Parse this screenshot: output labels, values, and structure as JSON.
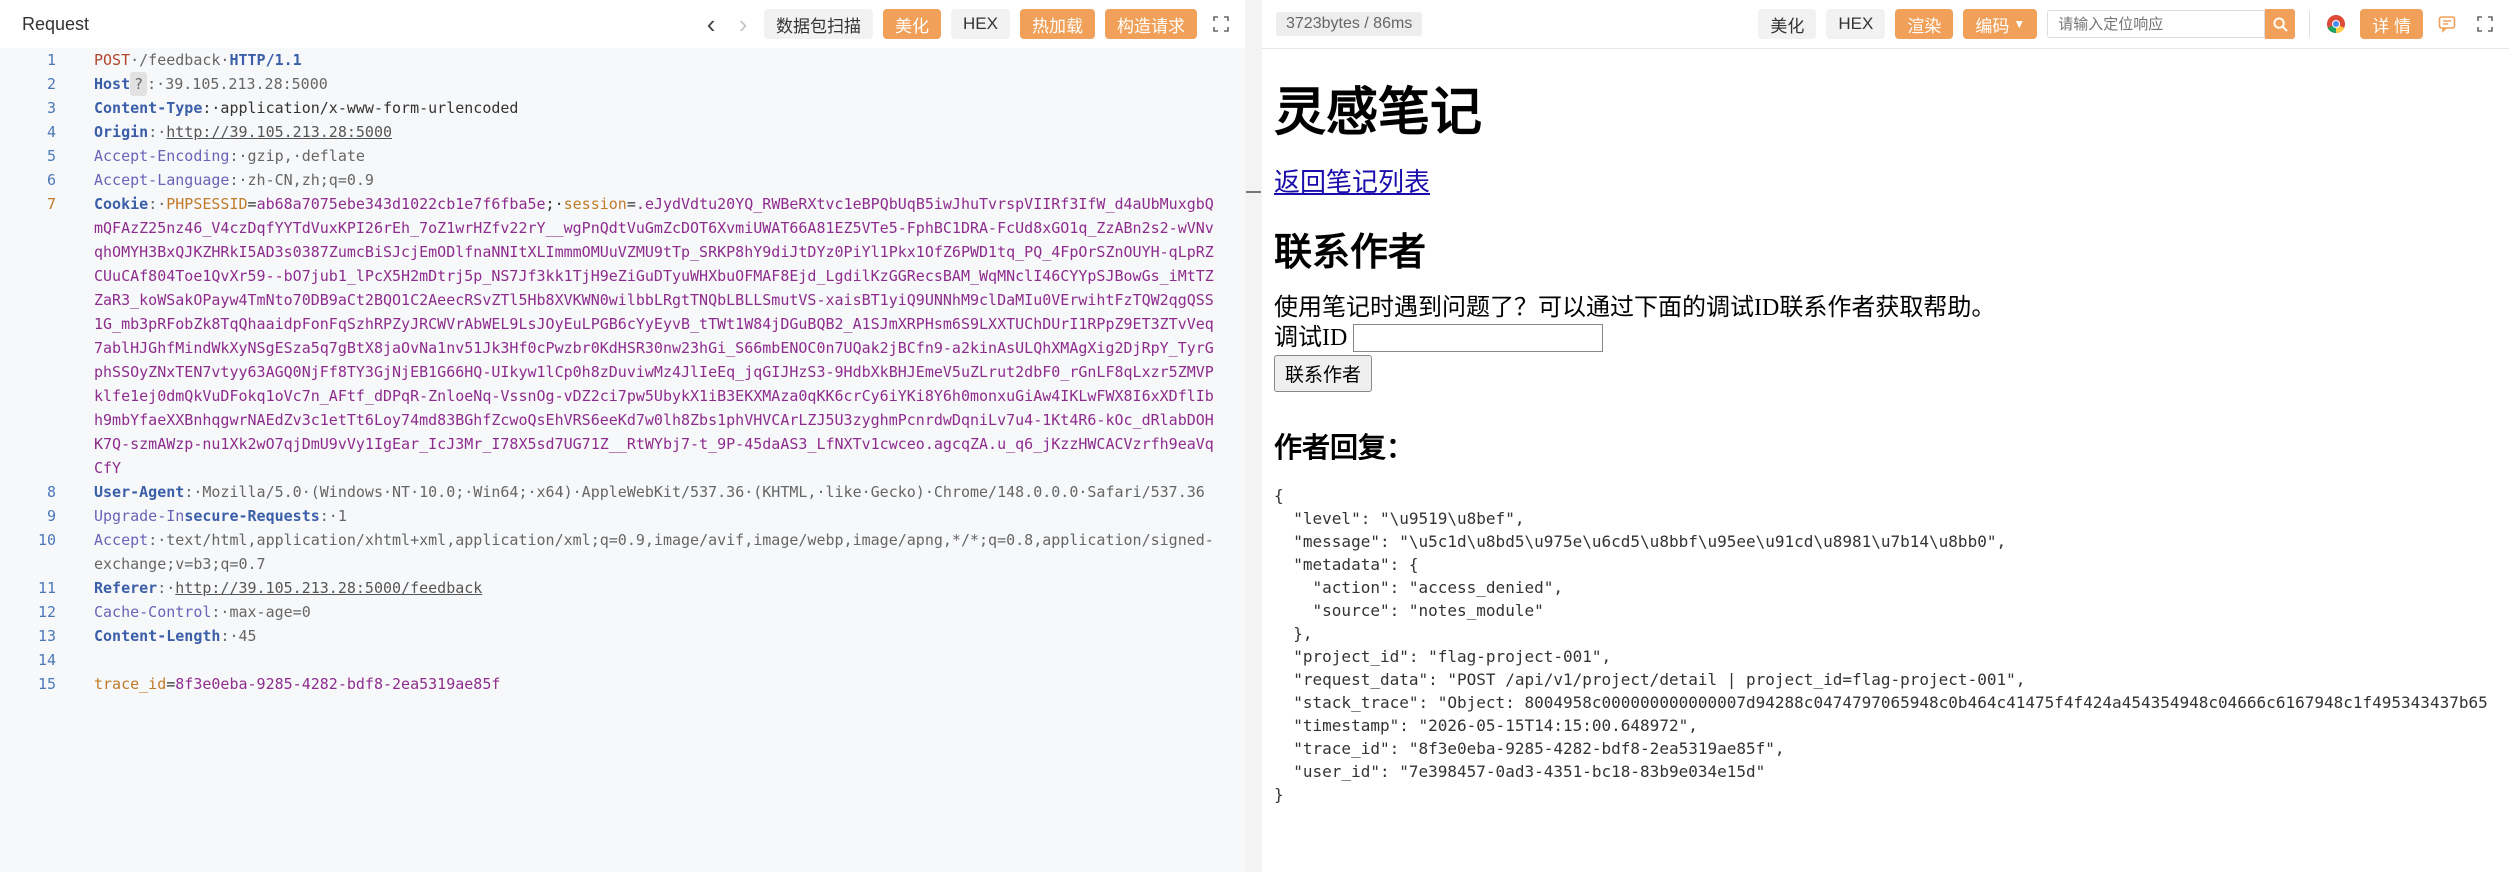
{
  "request_panel": {
    "title": "Request",
    "buttons": [
      "数据包扫描",
      "美化",
      "HEX",
      "热加载",
      "构造请求"
    ],
    "lines": [
      {
        "n": "1",
        "segs": [
          [
            "red",
            "POST"
          ],
          [
            "grey",
            "·/feedback·"
          ],
          [
            "k",
            "HTTP/1.1"
          ]
        ]
      },
      {
        "n": "2",
        "segs": [
          [
            "k",
            "Host"
          ],
          [
            "badge",
            "?"
          ],
          [
            "grey",
            ":·39.105.213.28:5000"
          ]
        ]
      },
      {
        "n": "3",
        "segs": [
          [
            "k",
            "Content-Type"
          ],
          [
            "",
            ":·application/x-www-form-urlencoded"
          ]
        ]
      },
      {
        "n": "4",
        "segs": [
          [
            "k",
            "Origin"
          ],
          [
            "grey",
            ":·"
          ],
          [
            "url",
            "http://39.105.213.28:5000"
          ]
        ]
      },
      {
        "n": "5",
        "segs": [
          [
            "kp",
            "Accept-Encoding"
          ],
          [
            "grey",
            ":·gzip,·deflate"
          ]
        ]
      },
      {
        "n": "6",
        "segs": [
          [
            "kp",
            "Accept-Language"
          ],
          [
            "grey",
            ":·zh-CN,zh;q=0.9"
          ]
        ]
      },
      {
        "n": "7",
        "segs": [
          [
            "k",
            "Cookie"
          ],
          [
            "grey",
            ":·"
          ],
          [
            "ck",
            "PHPSESSID"
          ],
          [
            "",
            "="
          ],
          [
            "cv",
            "ab68a7075ebe343d1022cb1e7f6fba5e"
          ],
          [
            "",
            ";·"
          ],
          [
            "ck",
            "session"
          ],
          [
            "",
            "="
          ],
          [
            "cv",
            ".eJydVdtu20YQ_RWBeRXtvc1eBPQbUqB5iwJhuTvrspVIIRf3IfW_d4aUbMuxgbQmQFAzZ25nz46_V4czDqfYYTdVuxKPI26rEh_7oZ1wrHZfv22rY__wgPnQdtVuGmZcDOT6XvmiUWAT66A81EZ5VTe5-FphBC1DRA-FcUd8xGO1q_ZzABn2s2-wVNvqhOMYH3BxQJKZHRkI5AD3s0387ZumcBiSJcjEmODlfnaNNItXLImmmOMUuVZMU9tTp_SRKP8hY9diJtDYz0PiYl1Pkx1OfZ6PWD1tq_PQ_4FpOrSZnOUYH-qLpRZCUuCAf804Toe1QvXr59--bO7jub1_lPcX5H2mDtrj5p_NS7Jf3kk1TjH9eZiGuDTyuWHXbuOFMAF8Ejd_LgdilKzGGRecsBAM_WqMNclI46CYYpSJBowGs_iMtTZZaR3_koWSakOPayw4TmNto70DB9aCt2BQO1C2AeecRSvZTl5Hb8XVKWN0wilbbLRgtTNQbLBLLSmutVS-xaisBT1yiQ9UNNhM9clDaMIu0VErwihtFzTQW2qgQSS1G_mb3pRFobZk8TqQhaaidpFonFqSzhRPZyJRCWVrAbWEL9LsJOyEuLPGB6cYyEyvB_tTWt1W84jDGuBQB2_A1SJmXRPHsm6S9LXXTUChDUrI1RPpZ9ET3ZTvVeq7ablHJGhfMindWkXyNSgESza5q7gBtX8jaOvNa1nv51Jk3Hf0cPwzbr0KdHSR30nw23hGi_S66mbENOC0n7UQak2jBCfn9-a2kinAsULQhXMAgXig2DjRpY_TyrGphSSOyZNxTEN7vtyy63AGQ0NjFf8TY3GjNjEB1G66HQ-UIkyw1lCp0h8zDuviwMz4JlIeEq_jqGIJHzS3-9HdbXkBHJEmeV5uZLrut2dbF0_rGnLF8qLxzr5ZMVPklfe1ej0dmQkVuDFokq1oVc7n_AFtf_dDPqR-ZnloeNq-VssnOg-vDZ2ci7pw5UbykX1iB3EKXMAza0qKK6crCy6iYKi8Y6h0monxuGiAw4IKLwFWX8I6xXDflIbh9mbYfaeXXBnhqgwrNAEdZv3c1etTt6Loy74md83BGhfZcwoQsEhVRS6eeKd7w0lh8Zbs1phVHVCArLZJ5U3zyghmPcnrdwDqniLv7u4-1Kt4R6-kOc_dRlabDOHK7Q-szmAWzp-nu1Xk2wO7qjDmU9vVy1IgEar_IcJ3Mr_I78X5sd7UG71Z__RtWYbj7-t_9P-45daAS3_LfNXTv1cwceo.agcqZA.u_q6_jKzzHWCACVzrfh9eaVqCfY"
          ]
        ]
      },
      {
        "n": "8",
        "segs": [
          [
            "k",
            "User-Agent"
          ],
          [
            "grey",
            ":·Mozilla/5.0·(Windows·NT·10.0;·Win64;·x64)·AppleWebKit/537.36·(KHTML,·like·Gecko)·Chrome/148.0.0.0·Safari/537.36"
          ]
        ]
      },
      {
        "n": "9",
        "segs": [
          [
            "kp",
            "Upgrade-In"
          ],
          [
            "k",
            "secure-Requests"
          ],
          [
            "grey",
            ":·1"
          ]
        ]
      },
      {
        "n": "10",
        "segs": [
          [
            "kp",
            "Accept"
          ],
          [
            "grey",
            ":·text/html,application/xhtml+xml,application/xml;q=0.9,image/avif,image/webp,image/apng,*/*;q=0.8,application/signed-exchange;v=b3;q=0.7"
          ]
        ]
      },
      {
        "n": "11",
        "segs": [
          [
            "k",
            "Referer"
          ],
          [
            "grey",
            ":·"
          ],
          [
            "url",
            "http://39.105.213.28:5000/feedback"
          ]
        ]
      },
      {
        "n": "12",
        "segs": [
          [
            "kp",
            "Cache-Control"
          ],
          [
            "grey",
            ":·max-age=0"
          ]
        ]
      },
      {
        "n": "13",
        "segs": [
          [
            "k",
            "Content-Length"
          ],
          [
            "grey",
            ":·45"
          ]
        ]
      },
      {
        "n": "14",
        "segs": []
      },
      {
        "n": "15",
        "segs": [
          [
            "ck",
            "trace_id"
          ],
          [
            "",
            "="
          ],
          [
            "cv",
            "8f3e0eba-9285-4282-bdf8-2ea5319ae85f"
          ]
        ]
      }
    ]
  },
  "response_panel": {
    "size_label": "3723bytes / 86ms",
    "btn_beautify": "美化",
    "btn_hex": "HEX",
    "btn_render": "渲染",
    "btn_encode": "编码",
    "search_placeholder": "请输入定位响应",
    "btn_detail": "详 情",
    "page": {
      "h1": "灵感笔记",
      "back_link": "返回笔记列表",
      "h2": "联系作者",
      "paragraph": "使用笔记时遇到问题了？可以通过下面的调试ID联系作者获取帮助。",
      "debug_label": "调试ID",
      "contact_button": "联系作者",
      "h3": "作者回复：",
      "json_text": "{\n  \"level\": \"\\u9519\\u8bef\",\n  \"message\": \"\\u5c1d\\u8bd5\\u975e\\u6cd5\\u8bbf\\u95ee\\u91cd\\u8981\\u7b14\\u8bb0\",\n  \"metadata\": {\n    \"action\": \"access_denied\",\n    \"source\": \"notes_module\"\n  },\n  \"project_id\": \"flag-project-001\",\n  \"request_data\": \"POST /api/v1/project/detail | project_id=flag-project-001\",\n  \"stack_trace\": \"Object: 8004958c000000000000007d94288c0474797065948c0b464c41475f4f424a454354948c04666c6167948c1f495343437b65\n  \"timestamp\": \"2026-05-15T14:15:00.648972\",\n  \"trace_id\": \"8f3e0eba-9285-4282-bdf8-2ea5319ae85f\",\n  \"user_id\": \"7e398457-0ad3-4351-bc18-83b9e034e15d\"\n}"
    }
  },
  "colors": {
    "accent": "#f0a058",
    "line_number": "#4a78b8",
    "header_key": "#3a5fa8",
    "cookie_value": "#8e2c8e",
    "method": "#b3452c"
  }
}
